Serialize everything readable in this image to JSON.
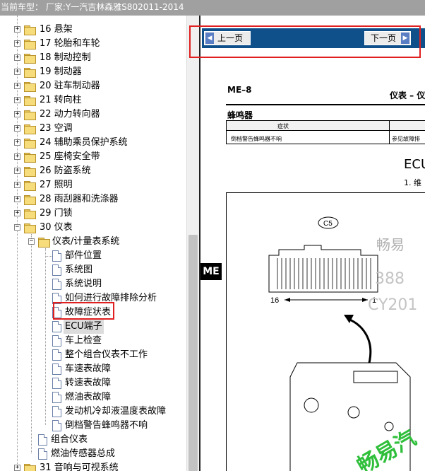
{
  "window": {
    "title": "当前车型：  厂家:Y一汽吉林森雅S802011-2014"
  },
  "tree": {
    "items": [
      {
        "label": "16 悬架"
      },
      {
        "label": "17 轮胎和车轮"
      },
      {
        "label": "18 制动控制"
      },
      {
        "label": "19 制动器"
      },
      {
        "label": "20 驻车制动器"
      },
      {
        "label": "21 转向柱"
      },
      {
        "label": "22 动力转向器"
      },
      {
        "label": "23 空调"
      },
      {
        "label": "24 辅助乘员保护系统"
      },
      {
        "label": "25 座椅安全带"
      },
      {
        "label": "26 防盗系统"
      },
      {
        "label": "27 照明"
      },
      {
        "label": "28 雨刮器和洗涤器"
      },
      {
        "label": "29 门锁"
      },
      {
        "label": "30 仪表"
      },
      {
        "label": "仪表/计量表系统"
      },
      {
        "label": "部件位置"
      },
      {
        "label": "系统图"
      },
      {
        "label": "系统说明"
      },
      {
        "label": "如何进行故障排除分析"
      },
      {
        "label": "故障症状表"
      },
      {
        "label": "ECU端子"
      },
      {
        "label": "车上检查"
      },
      {
        "label": "整个组合仪表不工作"
      },
      {
        "label": "车速表故障"
      },
      {
        "label": "转速表故障"
      },
      {
        "label": "燃油表故障"
      },
      {
        "label": "发动机冷却液温度表故障"
      },
      {
        "label": "倒档警告蜂鸣器不响"
      },
      {
        "label": "组合仪表"
      },
      {
        "label": "燃油传感器总成"
      },
      {
        "label": "31 音响与可视系统"
      }
    ]
  },
  "viewer": {
    "prev_label": "上一页",
    "next_label": "下一页",
    "page": {
      "code": "ME–8",
      "section": "仪表 – 仪",
      "heading": "蜂鸣器",
      "table_header": "症状",
      "table_cell_1": "倒档警告蜂鸣器不响",
      "table_cell_2": "参见故障排",
      "ecu_title": "ECU",
      "step": "1.  维",
      "side_tab": "ME",
      "connector_label": "C5",
      "pin_left": "16",
      "pin_right": "1",
      "watermark_1": "畅易",
      "watermark_2": "388",
      "watermark_3": "CY201",
      "watermark_4": "畅易汽"
    }
  },
  "colors": {
    "nav_bar": "#0f4f8a",
    "highlight_box": "#e02020",
    "titlebar": "#a0a0a0"
  }
}
